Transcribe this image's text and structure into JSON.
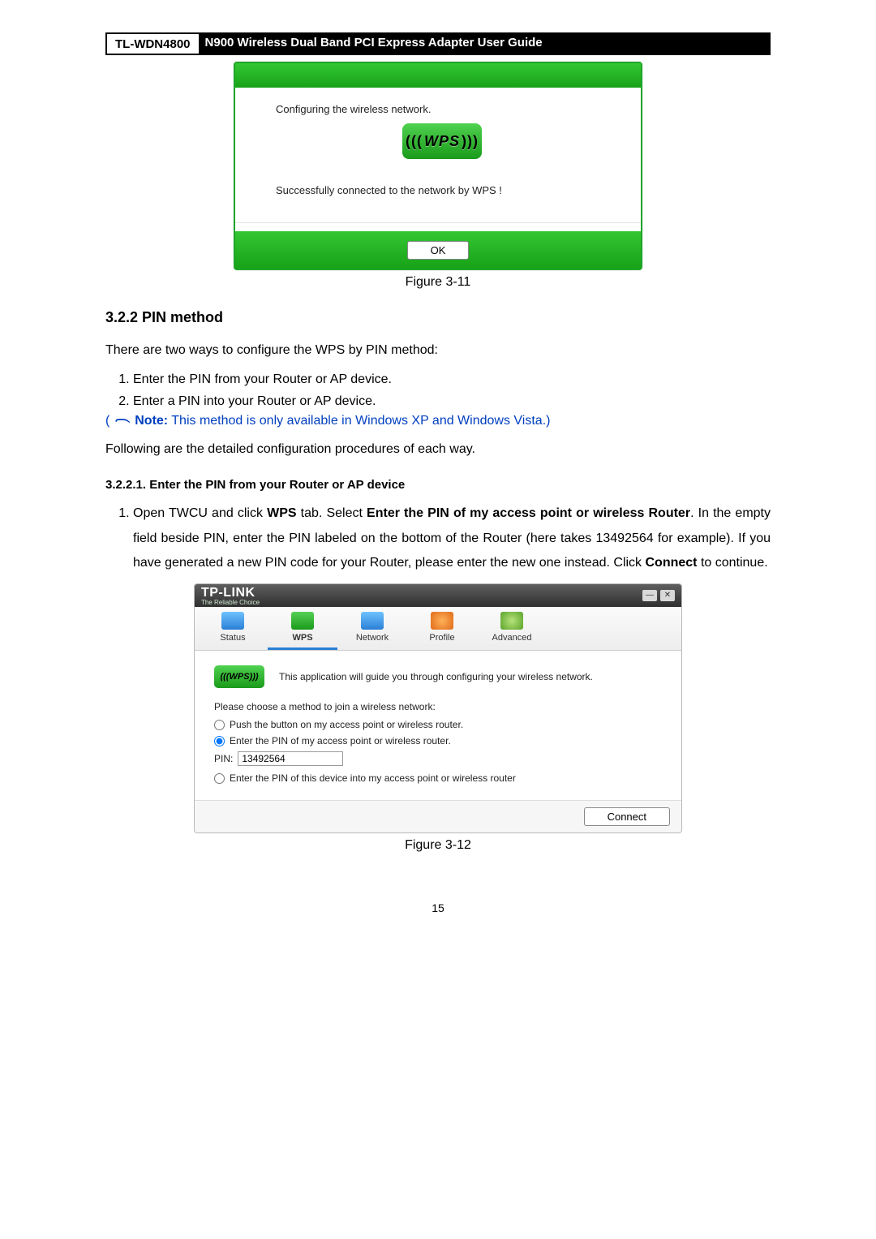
{
  "header": {
    "model": "TL-WDN4800",
    "title": "N900 Wireless Dual Band PCI Express Adapter User Guide"
  },
  "dlg1": {
    "configuring": "Configuring the wireless network.",
    "wps_label": "WPS",
    "success": "Successfully connected to the network by WPS !",
    "ok": "OK"
  },
  "fig1_caption": "Figure 3-11",
  "section": {
    "h3": "3.2.2  PIN method",
    "intro": "There are two ways to configure the WPS by PIN method:",
    "ways": [
      "Enter the PIN from your Router or AP device.",
      "Enter a PIN into your Router or AP device."
    ],
    "note_label": "Note:",
    "note_text": " This method is only available in Windows XP and Windows Vista.)",
    "note_open": "( ",
    "following": "Following are the detailed configuration procedures of each way.",
    "h4": "3.2.2.1.  Enter the PIN from your Router or AP device",
    "step1_a": "Open TWCU and click ",
    "step1_b": "WPS",
    "step1_c": " tab. Select ",
    "step1_d": "Enter the PIN of my access point or wireless Router",
    "step1_e": ". In the empty field beside PIN, enter the PIN labeled on the bottom of the Router (here takes 13492564 for example). If you have generated a new PIN code for your Router, please enter the new one instead. Click ",
    "step1_f": "Connect",
    "step1_g": " to continue."
  },
  "dlg2": {
    "brand": "TP-LINK",
    "brand_sub": "The Reliable Choice",
    "tabs": {
      "status": "Status",
      "wps": "WPS",
      "network": "Network",
      "profile": "Profile",
      "advanced": "Advanced"
    },
    "intro": "This application will guide you through configuring your wireless network.",
    "choose": "Please choose a method to join a wireless network:",
    "opt_push": "Push the button on my access point or wireless router.",
    "opt_enter": "Enter the PIN of my access point or wireless router.",
    "pin_label": "PIN:",
    "pin_value": "13492564",
    "opt_into": "Enter the PIN of this device into my access point or wireless router",
    "connect": "Connect"
  },
  "fig2_caption": "Figure 3-12",
  "page_num": "15"
}
